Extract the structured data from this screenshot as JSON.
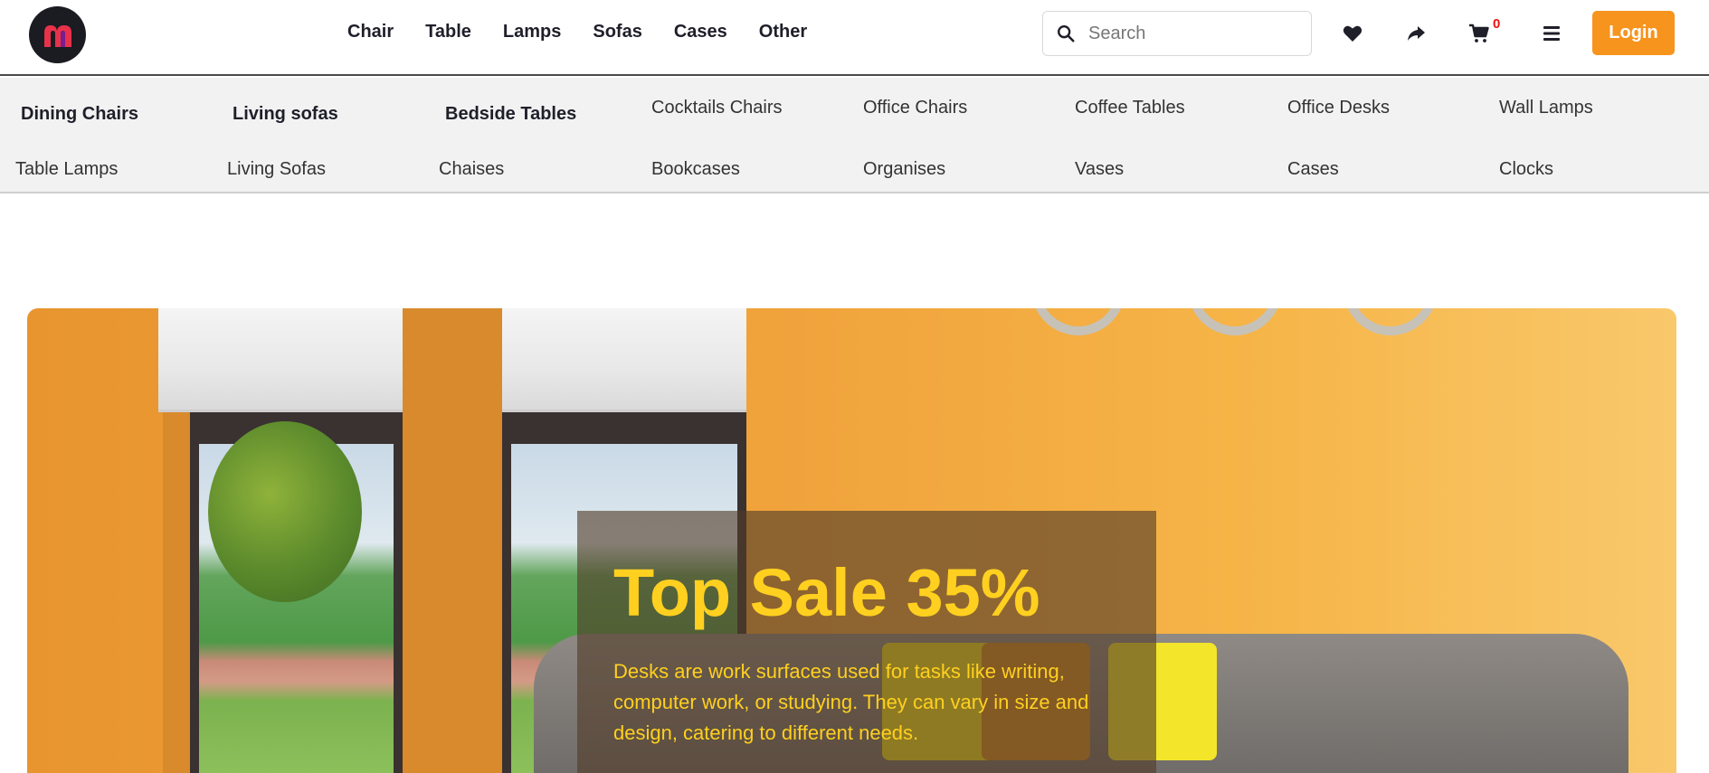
{
  "header": {
    "logo_letter": "m",
    "nav": [
      "Chair",
      "Table",
      "Lamps",
      "Sofas",
      "Cases",
      "Other"
    ],
    "search_placeholder": "Search",
    "cart_count": "0",
    "login_label": "Login",
    "icons": [
      "search-icon",
      "heart-icon",
      "share-icon",
      "cart-icon",
      "menu-icon"
    ],
    "accent_color": "#f7941e"
  },
  "categories": {
    "row1": [
      "Dining Chairs",
      "Living sofas",
      "Bedside Tables",
      "Cocktails Chairs",
      "Office Chairs",
      "Coffee Tables",
      "Office Desks",
      "Wall Lamps"
    ],
    "row2": [
      "Table Lamps",
      "Living Sofas",
      "Chaises",
      "Bookcases",
      "Organises",
      "Vases",
      "Cases",
      "Clocks"
    ]
  },
  "hero": {
    "title": "Top Sale 35%",
    "description": "Desks are work surfaces used for tasks like writing, computer work, or studying. They can vary in size and design, catering to different needs.",
    "text_color": "#ffd01f"
  }
}
